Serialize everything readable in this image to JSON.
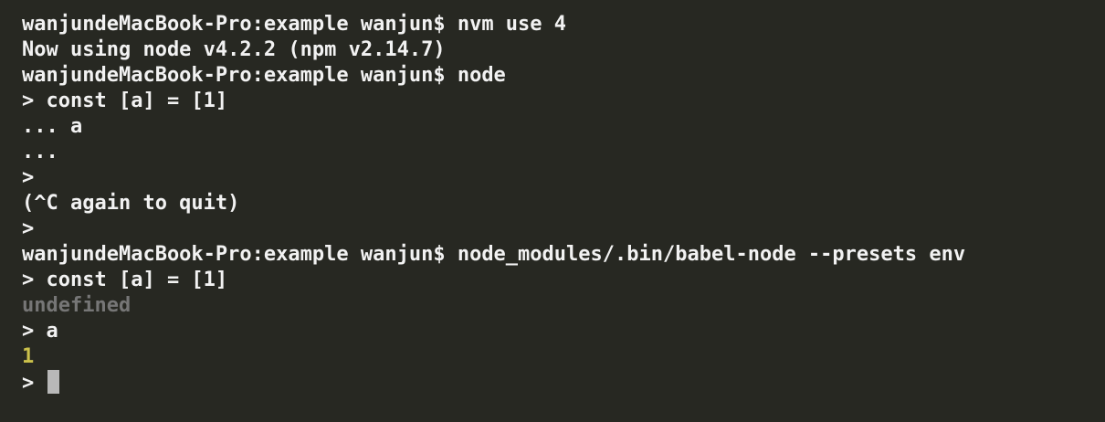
{
  "terminal": {
    "colors": {
      "background": "#272822",
      "text": "#f2f2f2",
      "dim_output": "#767676",
      "number_output": "#cbc14b",
      "cursor": "#b8b8b8"
    },
    "lines": [
      {
        "text": "wanjundeMacBook-Pro:example wanjun$ nvm use 4"
      },
      {
        "text": "Now using node v4.2.2 (npm v2.14.7)"
      },
      {
        "text": "wanjundeMacBook-Pro:example wanjun$ node"
      },
      {
        "text": "> const [a] = [1]"
      },
      {
        "text": "... a"
      },
      {
        "text": "..."
      },
      {
        "text": ">"
      },
      {
        "text": "(^C again to quit)"
      },
      {
        "text": ">"
      },
      {
        "text": "wanjundeMacBook-Pro:example wanjun$ node_modules/.bin/babel-node --presets env"
      },
      {
        "text": "> const [a] = [1]"
      },
      {
        "text": "undefined"
      },
      {
        "text": "> a"
      },
      {
        "text": "1"
      },
      {
        "text": "> "
      }
    ]
  }
}
